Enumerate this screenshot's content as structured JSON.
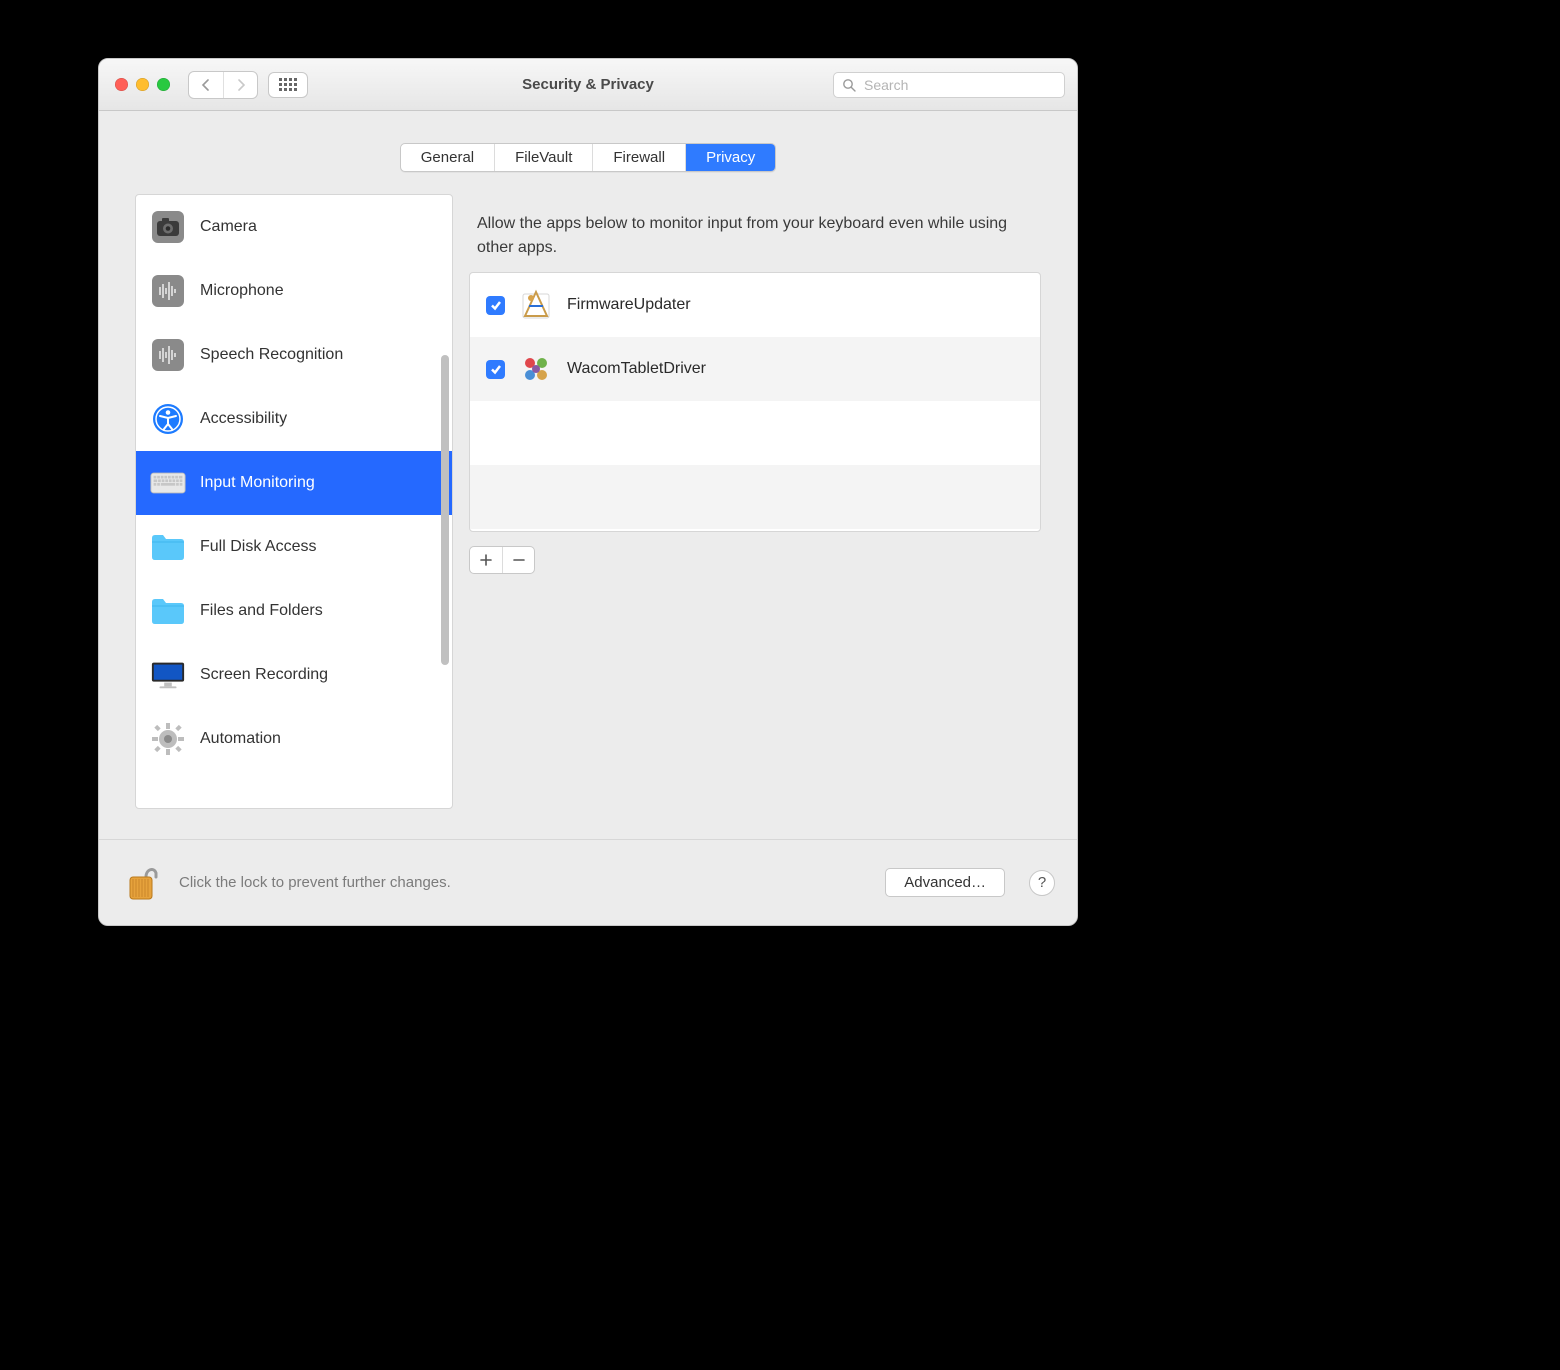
{
  "window": {
    "title": "Security & Privacy"
  },
  "search": {
    "placeholder": "Search"
  },
  "tabs": [
    {
      "label": "General",
      "active": false
    },
    {
      "label": "FileVault",
      "active": false
    },
    {
      "label": "Firewall",
      "active": false
    },
    {
      "label": "Privacy",
      "active": true
    }
  ],
  "sidebar": {
    "items": [
      {
        "label": "Camera",
        "icon": "camera"
      },
      {
        "label": "Microphone",
        "icon": "microphone"
      },
      {
        "label": "Speech Recognition",
        "icon": "speech"
      },
      {
        "label": "Accessibility",
        "icon": "accessibility"
      },
      {
        "label": "Input Monitoring",
        "icon": "keyboard",
        "selected": true
      },
      {
        "label": "Full Disk Access",
        "icon": "folder"
      },
      {
        "label": "Files and Folders",
        "icon": "folder"
      },
      {
        "label": "Screen Recording",
        "icon": "display"
      },
      {
        "label": "Automation",
        "icon": "gear"
      }
    ]
  },
  "detail": {
    "instruction": "Allow the apps below to monitor input from your keyboard even while using other apps.",
    "apps": [
      {
        "name": "FirmwareUpdater",
        "checked": true
      },
      {
        "name": "WacomTabletDriver",
        "checked": true
      }
    ]
  },
  "footer": {
    "lock_text": "Click the lock to prevent further changes.",
    "advanced_label": "Advanced…",
    "help_label": "?"
  }
}
